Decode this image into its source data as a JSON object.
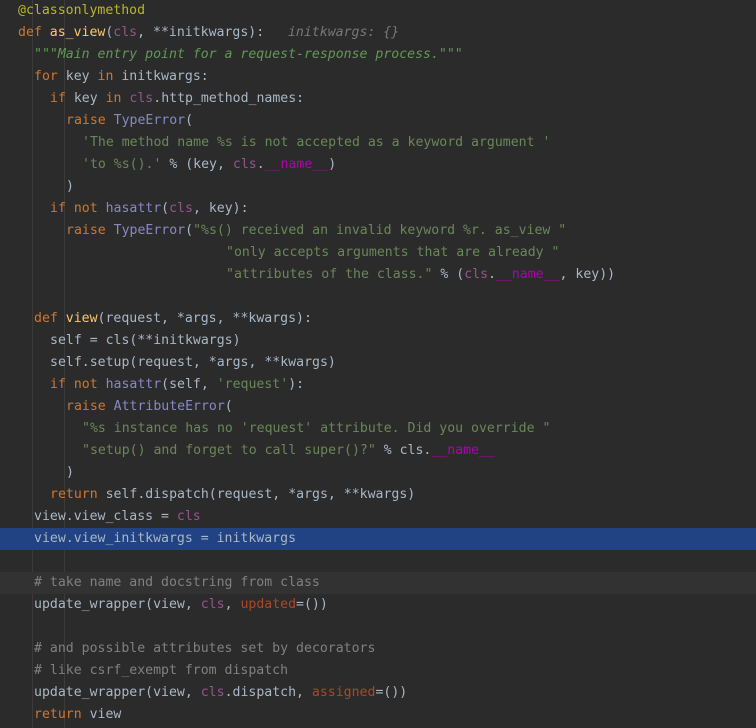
{
  "editor": {
    "language": "python",
    "colors": {
      "background": "#2b2b2b",
      "selection": "#214283",
      "current_line": "#323232"
    },
    "lines": [
      {
        "indent": 2,
        "tokens": [
          {
            "t": "@classonlymethod",
            "k": "deco"
          }
        ]
      },
      {
        "indent": 2,
        "tokens": [
          {
            "t": "def ",
            "k": "kw"
          },
          {
            "t": "as_view",
            "k": "fn"
          },
          {
            "t": "(",
            "k": "plain"
          },
          {
            "t": "cls",
            "k": "self"
          },
          {
            "t": ", **initkwargs):",
            "k": "plain"
          },
          {
            "t": "   initkwargs: {}",
            "k": "hint"
          }
        ]
      },
      {
        "indent": 4,
        "tokens": [
          {
            "t": "\"\"\"Main entry point for a request-response process.\"\"\"",
            "k": "doc"
          }
        ]
      },
      {
        "indent": 4,
        "tokens": [
          {
            "t": "for ",
            "k": "kw"
          },
          {
            "t": "key ",
            "k": "plain"
          },
          {
            "t": "in ",
            "k": "kw"
          },
          {
            "t": "initkwargs:",
            "k": "plain"
          }
        ]
      },
      {
        "indent": 6,
        "tokens": [
          {
            "t": "if ",
            "k": "kw"
          },
          {
            "t": "key ",
            "k": "plain"
          },
          {
            "t": "in ",
            "k": "kw"
          },
          {
            "t": "cls",
            "k": "self"
          },
          {
            "t": ".http_method_names:",
            "k": "plain"
          }
        ]
      },
      {
        "indent": 8,
        "tokens": [
          {
            "t": "raise ",
            "k": "kw"
          },
          {
            "t": "TypeError",
            "k": "bi"
          },
          {
            "t": "(",
            "k": "plain"
          }
        ]
      },
      {
        "indent": 10,
        "tokens": [
          {
            "t": "'The method name %s is not accepted as a keyword argument '",
            "k": "str"
          }
        ]
      },
      {
        "indent": 10,
        "tokens": [
          {
            "t": "'to %s().'",
            "k": "str"
          },
          {
            "t": " % (key, ",
            "k": "plain"
          },
          {
            "t": "cls",
            "k": "self"
          },
          {
            "t": ".",
            "k": "plain"
          },
          {
            "t": "__name__",
            "k": "dun"
          },
          {
            "t": ")",
            "k": "plain"
          }
        ]
      },
      {
        "indent": 8,
        "tokens": [
          {
            "t": ")",
            "k": "plain"
          }
        ]
      },
      {
        "indent": 6,
        "tokens": [
          {
            "t": "if not ",
            "k": "kw"
          },
          {
            "t": "hasattr",
            "k": "bi"
          },
          {
            "t": "(",
            "k": "plain"
          },
          {
            "t": "cls",
            "k": "self"
          },
          {
            "t": ", key):",
            "k": "plain"
          }
        ]
      },
      {
        "indent": 8,
        "tokens": [
          {
            "t": "raise ",
            "k": "kw"
          },
          {
            "t": "TypeError",
            "k": "bi"
          },
          {
            "t": "(",
            "k": "plain"
          },
          {
            "t": "\"%s() received an invalid keyword %r. as_view \"",
            "k": "str"
          }
        ]
      },
      {
        "indent": 28,
        "tokens": [
          {
            "t": "\"only accepts arguments that are already \"",
            "k": "str"
          }
        ]
      },
      {
        "indent": 28,
        "tokens": [
          {
            "t": "\"attributes of the class.\"",
            "k": "str"
          },
          {
            "t": " % (",
            "k": "plain"
          },
          {
            "t": "cls",
            "k": "self"
          },
          {
            "t": ".",
            "k": "plain"
          },
          {
            "t": "__name__",
            "k": "dun"
          },
          {
            "t": ", key))",
            "k": "plain"
          }
        ]
      },
      {
        "indent": 0,
        "tokens": []
      },
      {
        "indent": 4,
        "tokens": [
          {
            "t": "def ",
            "k": "kw"
          },
          {
            "t": "view",
            "k": "fn"
          },
          {
            "t": "(request, *args, **kwargs):",
            "k": "plain"
          }
        ]
      },
      {
        "indent": 6,
        "tokens": [
          {
            "t": "self = cls(**initkwargs)",
            "k": "plain"
          }
        ]
      },
      {
        "indent": 6,
        "tokens": [
          {
            "t": "self.setup(request, *args, **kwargs)",
            "k": "plain"
          }
        ]
      },
      {
        "indent": 6,
        "tokens": [
          {
            "t": "if not ",
            "k": "kw"
          },
          {
            "t": "hasattr",
            "k": "bi"
          },
          {
            "t": "(self, ",
            "k": "plain"
          },
          {
            "t": "'request'",
            "k": "str"
          },
          {
            "t": "):",
            "k": "plain"
          }
        ]
      },
      {
        "indent": 8,
        "tokens": [
          {
            "t": "raise ",
            "k": "kw"
          },
          {
            "t": "AttributeError",
            "k": "bi"
          },
          {
            "t": "(",
            "k": "plain"
          }
        ]
      },
      {
        "indent": 10,
        "tokens": [
          {
            "t": "\"%s instance has no 'request' attribute. Did you override \"",
            "k": "str"
          }
        ]
      },
      {
        "indent": 10,
        "tokens": [
          {
            "t": "\"setup() and forget to call super()?\"",
            "k": "str"
          },
          {
            "t": " % cls.",
            "k": "plain"
          },
          {
            "t": "__name__",
            "k": "dun"
          }
        ]
      },
      {
        "indent": 8,
        "tokens": [
          {
            "t": ")",
            "k": "plain"
          }
        ]
      },
      {
        "indent": 6,
        "tokens": [
          {
            "t": "return ",
            "k": "kw"
          },
          {
            "t": "self.dispatch(request, *args, **kwargs)",
            "k": "plain"
          }
        ]
      },
      {
        "indent": 4,
        "tokens": [
          {
            "t": "view.view_class = ",
            "k": "plain"
          },
          {
            "t": "cls",
            "k": "self"
          }
        ]
      },
      {
        "indent": 4,
        "selected": true,
        "tokens": [
          {
            "t": "view.view_initkwargs = initkwargs",
            "k": "plain"
          }
        ]
      },
      {
        "indent": 0,
        "tokens": []
      },
      {
        "indent": 4,
        "current": true,
        "tokens": [
          {
            "t": "# take name and docstring from class",
            "k": "cmt"
          }
        ]
      },
      {
        "indent": 4,
        "tokens": [
          {
            "t": "update_wrapper(view, ",
            "k": "plain"
          },
          {
            "t": "cls",
            "k": "self"
          },
          {
            "t": ", ",
            "k": "plain"
          },
          {
            "t": "updated",
            "k": "kwa"
          },
          {
            "t": "=())",
            "k": "plain"
          }
        ]
      },
      {
        "indent": 0,
        "tokens": []
      },
      {
        "indent": 4,
        "tokens": [
          {
            "t": "# and possible attributes set by decorators",
            "k": "cmt"
          }
        ]
      },
      {
        "indent": 4,
        "tokens": [
          {
            "t": "# like csrf_exempt from dispatch",
            "k": "cmt"
          }
        ]
      },
      {
        "indent": 4,
        "tokens": [
          {
            "t": "update_wrapper(view, ",
            "k": "plain"
          },
          {
            "t": "cls",
            "k": "self"
          },
          {
            "t": ".dispatch, ",
            "k": "plain"
          },
          {
            "t": "assigned",
            "k": "kwa"
          },
          {
            "t": "=())",
            "k": "plain"
          }
        ]
      },
      {
        "indent": 4,
        "tokens": [
          {
            "t": "return ",
            "k": "kw"
          },
          {
            "t": "view",
            "k": "plain"
          }
        ]
      }
    ]
  }
}
